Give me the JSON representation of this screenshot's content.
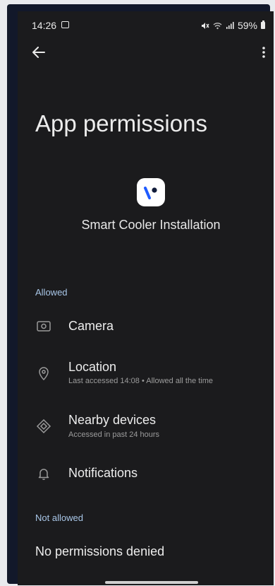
{
  "status_bar": {
    "time": "14:26",
    "battery": "59%"
  },
  "page": {
    "title": "App permissions",
    "app_name": "Smart Cooler Installation"
  },
  "sections": {
    "allowed_label": "Allowed",
    "not_allowed_label": "Not allowed"
  },
  "permissions_allowed": [
    {
      "title": "Camera",
      "subtitle": "",
      "icon": "camera-icon"
    },
    {
      "title": "Location",
      "subtitle": "Last accessed 14:08 • Allowed all the time",
      "icon": "location-pin-icon"
    },
    {
      "title": "Nearby devices",
      "subtitle": "Accessed in past 24 hours",
      "icon": "nearby-devices-icon"
    },
    {
      "title": "Notifications",
      "subtitle": "",
      "icon": "bell-icon"
    }
  ],
  "not_allowed_text": "No permissions denied",
  "colors": {
    "background": "#1b1b1d",
    "section_label": "#a9c7e8",
    "app_icon_accent": "#1f5bff"
  }
}
